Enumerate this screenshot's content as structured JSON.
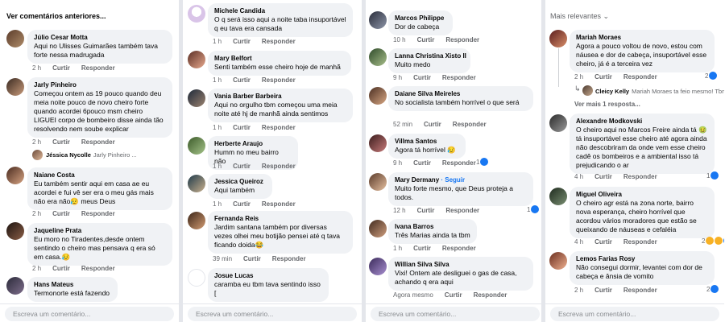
{
  "labels": {
    "like": "Curtir",
    "reply": "Responder",
    "input_placeholder": "Escreva um comentário..."
  },
  "panel1": {
    "header": "Ver comentários anteriores...",
    "comments": [
      {
        "name": "Júlio Cesar Motta",
        "text": "Aqui no Ulisses Guimarães também tava forte nessa madrugada",
        "time": "2 h"
      },
      {
        "name": "Jarly Pinheiro",
        "text": "Começou ontem as 19 pouco quando deu meia noite pouco de novo cheiro forte quando acordei 6pouco msm cheiro LIGUEI corpo de bombeiro disse ainda tão resolvendo nem soube explicar",
        "time": "2 h",
        "reply": {
          "name": "Jéssica Nycolle",
          "text": "Jarly Pinheiro ..."
        }
      },
      {
        "name": "Naiane Costa",
        "text": "Eu também sentir aqui em casa ae eu acordei e fui vê ser era o meu gás mais não era não😥 meus Deus",
        "time": "2 h"
      },
      {
        "name": "Jaqueline Prata",
        "text": "Eu moro no Tiradentes,desde ontem sentindo o cheiro mas pensava q era só em casa.😥",
        "time": "2 h"
      },
      {
        "name": "Hans Mateus",
        "text": "Termonorte está fazendo"
      }
    ]
  },
  "panel2": {
    "comments": [
      {
        "name": "Michele Candida",
        "text": "O q será isso aqui a noite taba insuportável q eu tava era cansada",
        "time": "1 h"
      },
      {
        "name": "Mary Belfort",
        "text": "Senti também esse cheiro hoje de manhã",
        "time": "1 h"
      },
      {
        "name": "Vania Barber Barbeira",
        "text": "Aqui no orgulho tbm começou uma meia noite até hj de manhã ainda sentimos",
        "time": "1 h"
      },
      {
        "name": "Herberte Araujo",
        "text": "Humm no meu bairro não",
        "time": "1 h"
      },
      {
        "name": "Jessica Queiroz",
        "text": "Aqui também",
        "time": "1 h"
      },
      {
        "name": "Fernanda Reis",
        "text": "Jardim santana também por diversas vezes olhei meu botijão pensei até q tava ficando doida😂",
        "time": "39 min"
      },
      {
        "name": "Josue Lucas",
        "text": "caramba eu tbm tava sentindo isso ["
      }
    ]
  },
  "panel3": {
    "comments": [
      {
        "name": "Marcos Philippe",
        "text": "Dor de cabeça",
        "time": "10 h"
      },
      {
        "name": "Lanna Christina Xisto II",
        "text": "Muito medo",
        "time": "9 h"
      },
      {
        "name": "Daiane Silva Meireles",
        "text": "No socialista também horrível o que será",
        "time": "52 min"
      },
      {
        "name": "Villma Santos",
        "text": "Agora tá horrível 😥",
        "time": "9 h",
        "reactions": "1"
      },
      {
        "name": "Mary Dermany",
        "follow": "· Seguir",
        "text": "Muito forte mesmo, que Deus proteja a todos.",
        "time": "12 h",
        "reactions": "1"
      },
      {
        "name": "Ivana Barros",
        "text": "Três Marias ainda ta tbm",
        "time": "1 h"
      },
      {
        "name": "Willian Silva Silva",
        "text": "Vixi! Ontem ate desliguei o gas de casa, achando q era aqui",
        "time": "Agora mesmo"
      }
    ]
  },
  "panel4": {
    "header": "Mais relevantes",
    "comments": [
      {
        "name": "Mariah Moraes",
        "text": "Agora a pouco voltou de novo, estou com náusea e dor de cabeça, insuportável esse cheiro, já é a terceira vez",
        "time": "2 h",
        "reactions": "2",
        "reply": {
          "name": "Cleicy Kelly",
          "text": "Mariah Moraes ta feio mesmo! Tbm..."
        },
        "more": "Ver mais 1 resposta..."
      },
      {
        "name": "Alexandre Modkovski",
        "text": "O cheiro aqui no Marcos Freire ainda tá 🤢 tá insuportável esse cheiro até agora ainda não descobriram da onde vem esse cheiro cadê os bombeiros e a ambiental isso tá prejudicando o ar",
        "time": "4 h",
        "reactions": "1"
      },
      {
        "name": "Miguel Oliveira",
        "text": "O cheiro agr está na zona norte, bairro nova esperança, cheiro horrível que acordou vários moradores que estão se queixando de náuseas e cefaléia",
        "time": "4 h",
        "reactions": "2"
      },
      {
        "name": "Lemos Farias Rosy",
        "text": "Não consegui dormir, levantei com dor de cabeça e ânsia de vomito",
        "time": "2 h",
        "reactions": "2"
      }
    ]
  },
  "colors": {
    "bubble": "#f0f2f5",
    "link": "#1877f2",
    "muted": "#65676b"
  }
}
